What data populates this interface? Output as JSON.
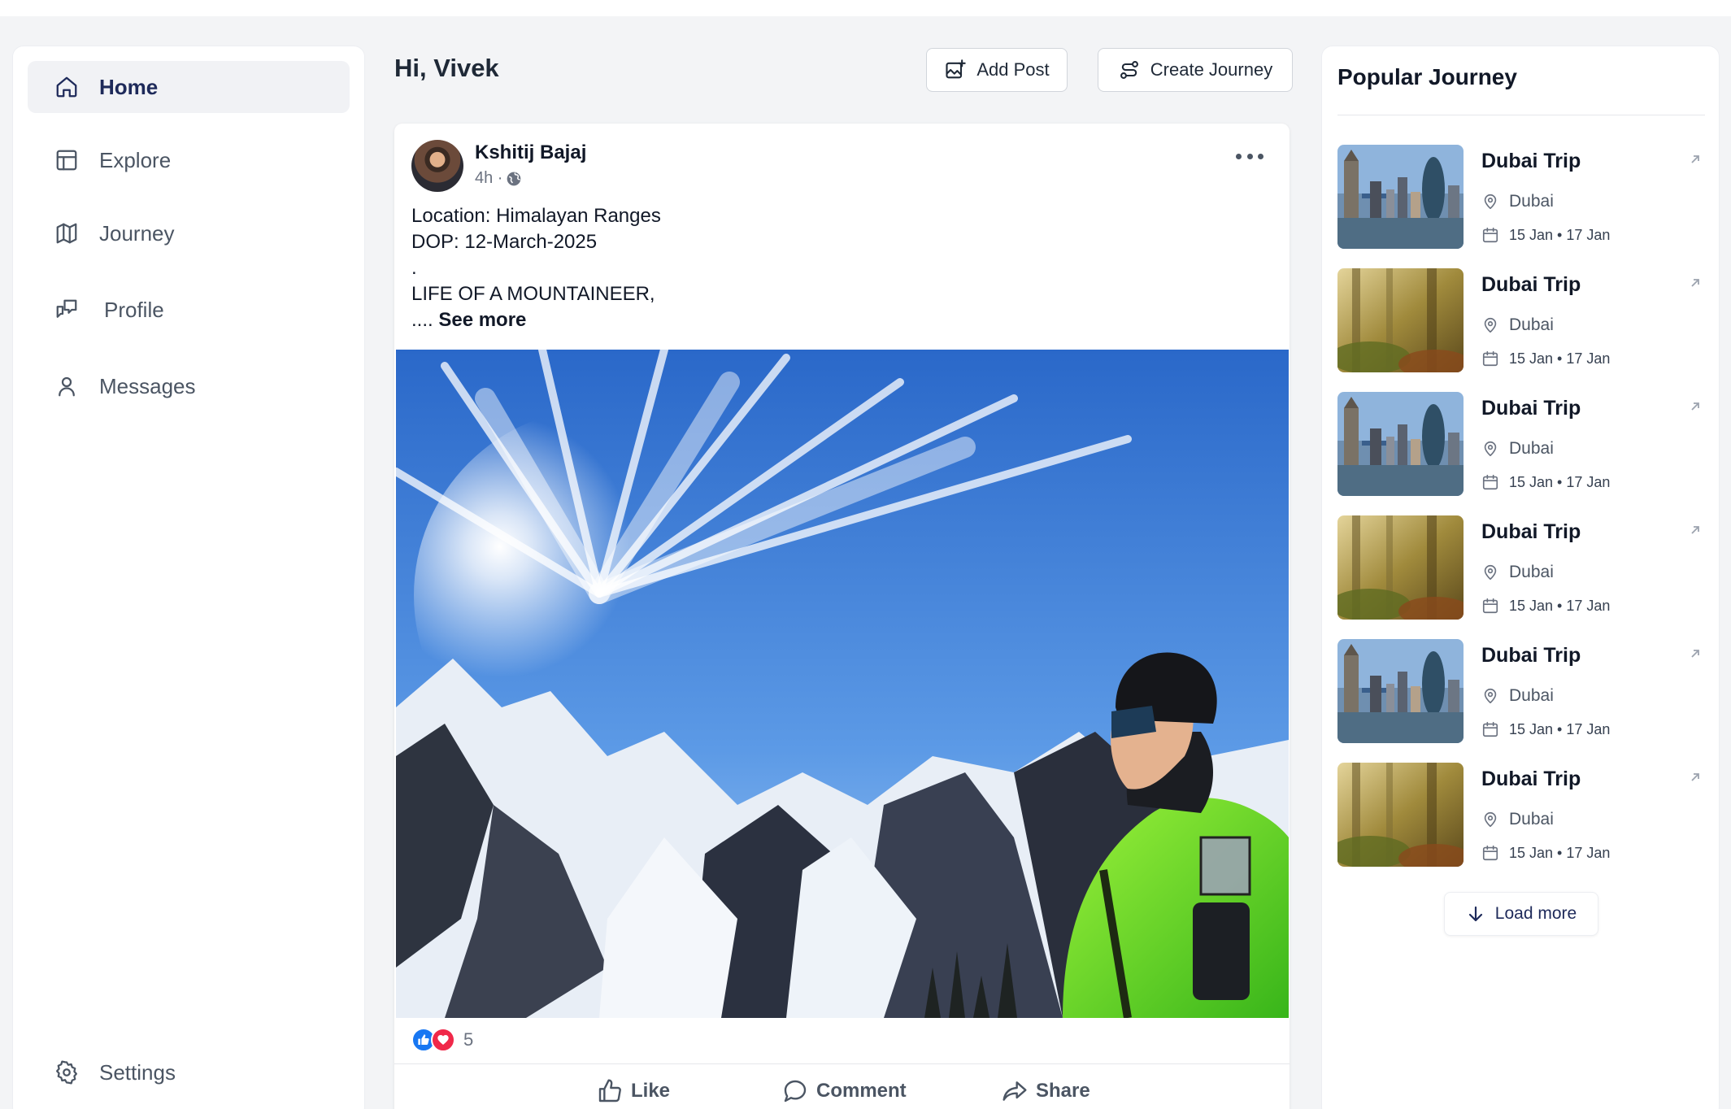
{
  "sidebar": {
    "items": [
      {
        "label": "Home",
        "icon": "home-icon",
        "active": true
      },
      {
        "label": "Explore",
        "icon": "layout-icon",
        "active": false
      },
      {
        "label": "Journey",
        "icon": "map-icon",
        "active": false
      },
      {
        "label": "Profile",
        "icon": "chat-icon",
        "active": false
      },
      {
        "label": "Messages",
        "icon": "user-icon",
        "active": false
      }
    ],
    "settings_label": "Settings"
  },
  "header": {
    "greeting": "Hi, Vivek",
    "add_post_label": "Add Post",
    "create_journey_label": "Create Journey"
  },
  "post": {
    "author": "Kshitij Bajaj",
    "time": "4h ·",
    "lines": [
      "Location: Himalayan Ranges",
      "DOP: 12-March-2025",
      ".",
      "LIFE OF A MOUNTAINEER,"
    ],
    "ellipsis": "....",
    "see_more": "See more",
    "reaction_count": "5",
    "actions": {
      "like": "Like",
      "comment": "Comment",
      "share": "Share"
    }
  },
  "popular": {
    "title": "Popular Journey",
    "items": [
      {
        "title": "Dubai Trip",
        "location": "Dubai",
        "dates": "15 Jan • 17 Jan",
        "thumb": "city"
      },
      {
        "title": "Dubai Trip",
        "location": "Dubai",
        "dates": "15 Jan • 17 Jan",
        "thumb": "forest"
      },
      {
        "title": "Dubai Trip",
        "location": "Dubai",
        "dates": "15 Jan • 17 Jan",
        "thumb": "city"
      },
      {
        "title": "Dubai Trip",
        "location": "Dubai",
        "dates": "15 Jan • 17 Jan",
        "thumb": "forest"
      },
      {
        "title": "Dubai Trip",
        "location": "Dubai",
        "dates": "15 Jan • 17 Jan",
        "thumb": "city"
      },
      {
        "title": "Dubai Trip",
        "location": "Dubai",
        "dates": "15 Jan • 17 Jan",
        "thumb": "forest"
      }
    ],
    "load_more": "Load more"
  },
  "colors": {
    "accent": "#1e2a5a",
    "like_blue": "#1877f2",
    "love_red": "#f02849"
  }
}
